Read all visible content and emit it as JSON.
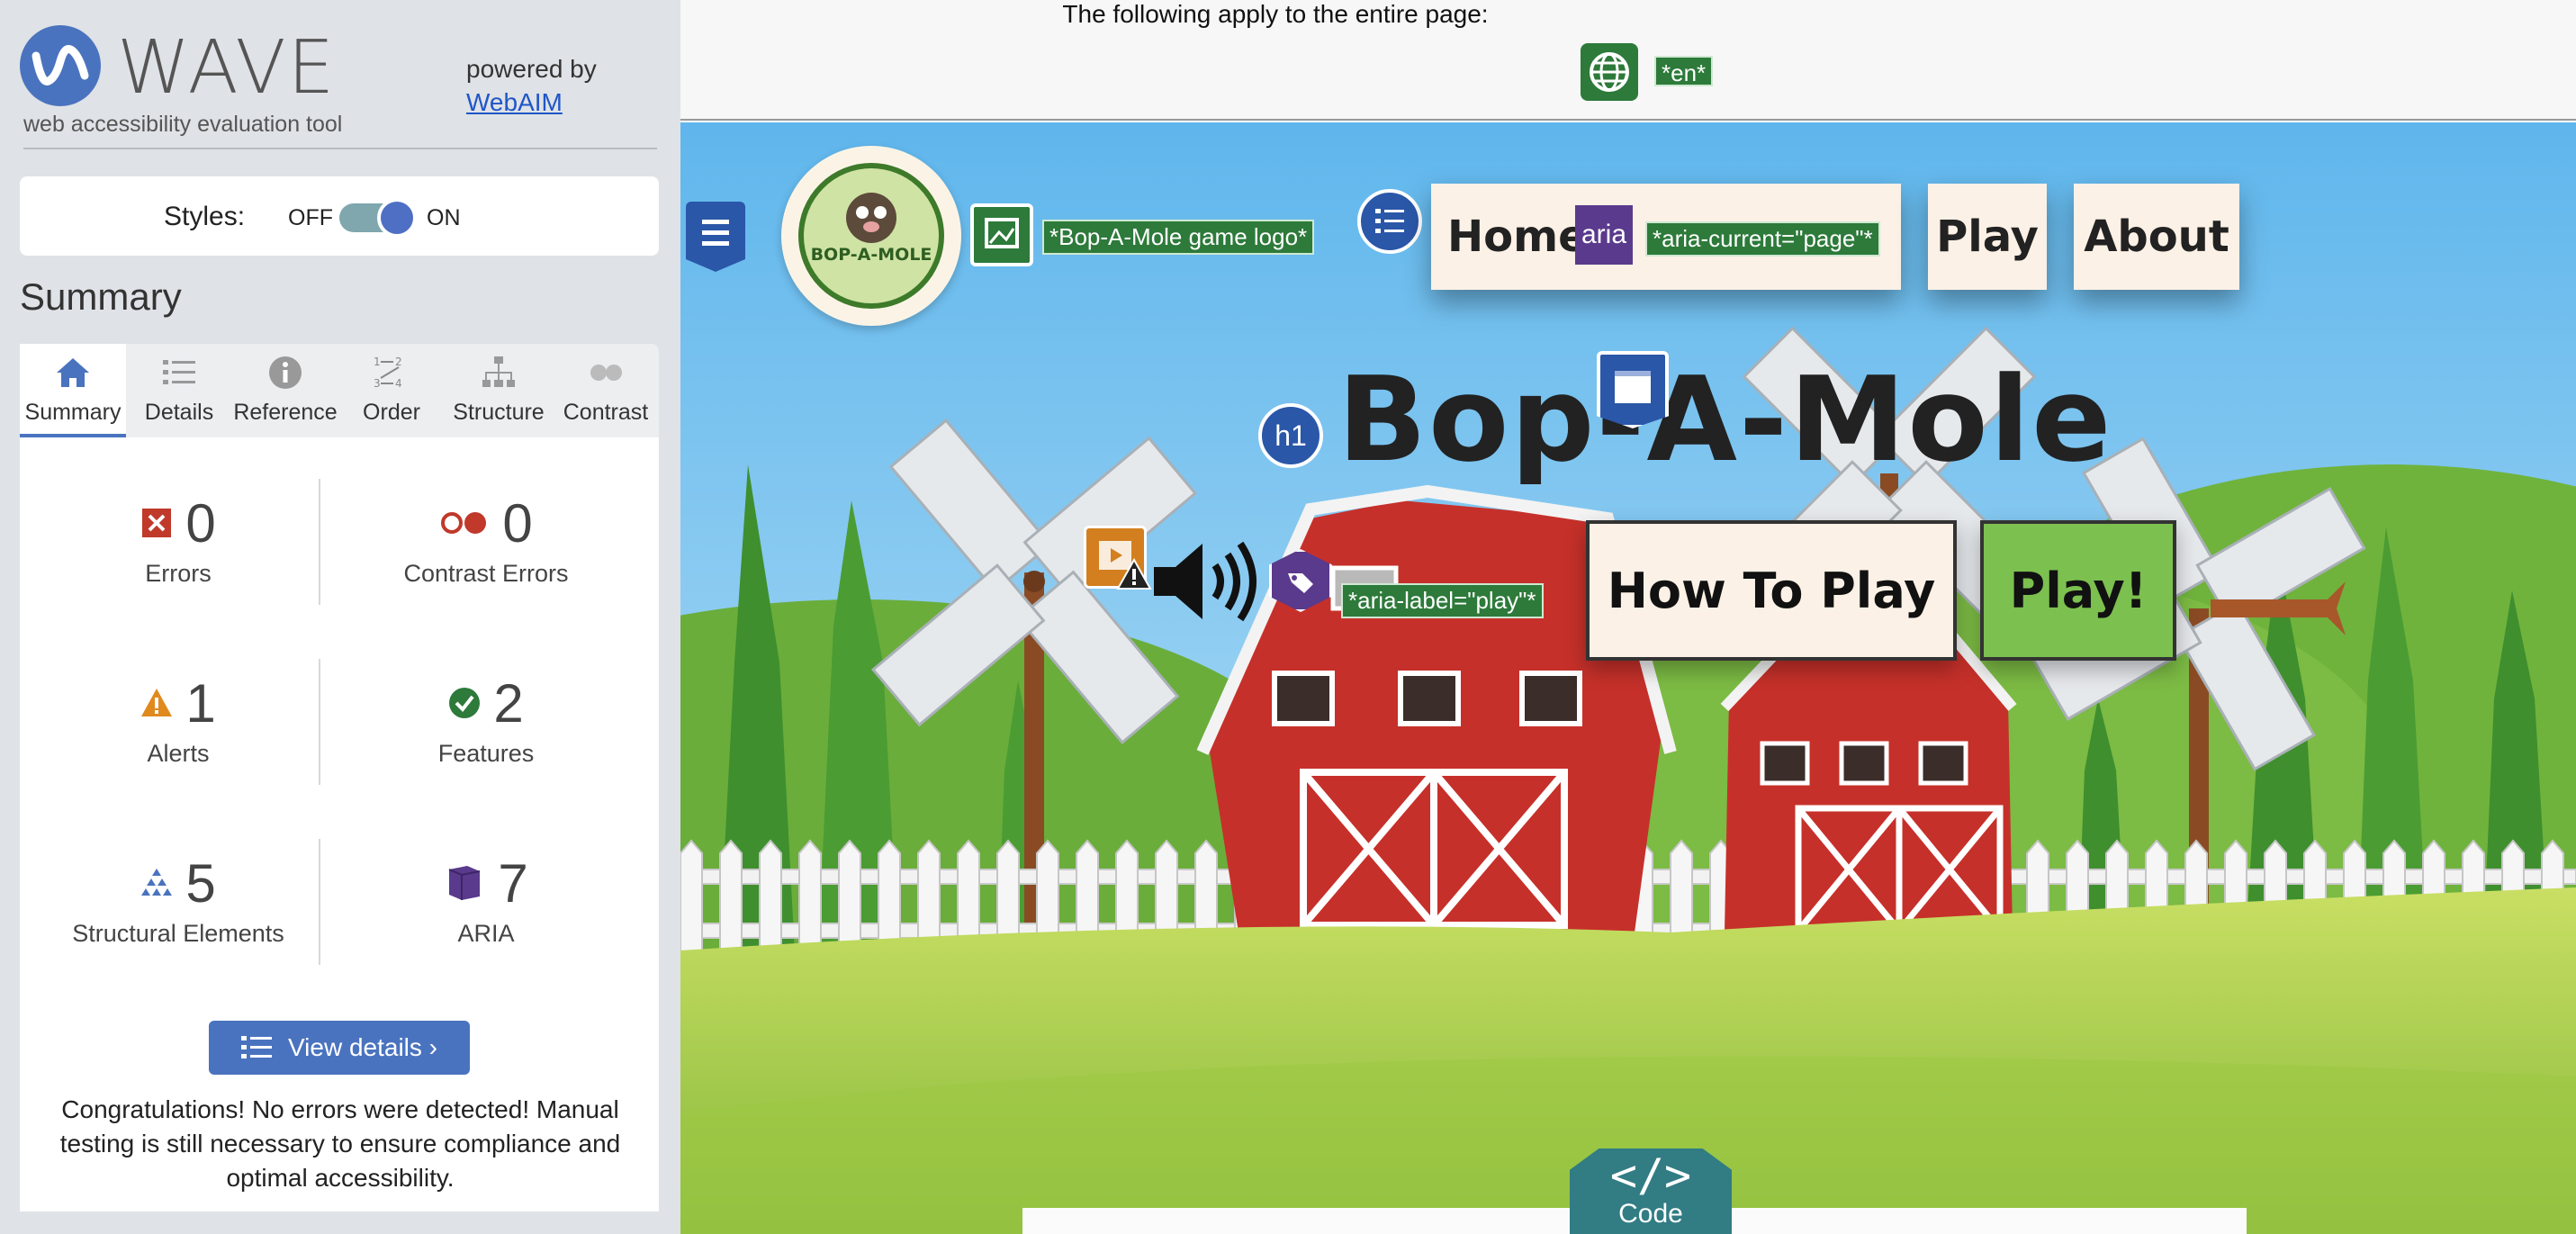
{
  "panel": {
    "brand": "WAVE",
    "tagline": "web accessibility evaluation tool",
    "powered_by": "powered by",
    "webaim_link": "WebAIM",
    "styles_label": "Styles:",
    "styles_off": "OFF",
    "styles_on": "ON",
    "styles_enabled": true,
    "summary_heading": "Summary",
    "tabs": [
      {
        "label": "Summary",
        "icon": "home-icon",
        "active": true
      },
      {
        "label": "Details",
        "icon": "list-icon",
        "active": false
      },
      {
        "label": "Reference",
        "icon": "info-icon",
        "active": false
      },
      {
        "label": "Order",
        "icon": "order-icon",
        "active": false
      },
      {
        "label": "Structure",
        "icon": "structure-icon",
        "active": false
      },
      {
        "label": "Contrast",
        "icon": "contrast-icon",
        "active": false
      }
    ],
    "stats": {
      "errors": {
        "count": "0",
        "label": "Errors"
      },
      "contrast_errors": {
        "count": "0",
        "label": "Contrast Errors"
      },
      "alerts": {
        "count": "1",
        "label": "Alerts"
      },
      "features": {
        "count": "2",
        "label": "Features"
      },
      "structural": {
        "count": "5",
        "label": "Structural Elements"
      },
      "aria": {
        "count": "7",
        "label": "ARIA"
      }
    },
    "view_details_label": "View details ›",
    "congrats": "Congratulations! No errors were detected! Manual testing is still necessary to ensure compliance and optimal accessibility."
  },
  "notice": {
    "text": "The following apply to the entire page:",
    "lang_tag": "*en*"
  },
  "page": {
    "logo_alt_tag": "*Bop-A-Mole game logo*",
    "logo_text": "BOP-A-MOLE",
    "nav": {
      "home": "Home",
      "aria_badge": "aria",
      "aria_current_tag": "*aria-current=\"page\"*",
      "play": "Play",
      "about": "About"
    },
    "h1_badge": "h1",
    "title": "Bop-A-Mole",
    "aria_label_tag": "*aria-label=\"play\"*",
    "how_to_play": "How To Play",
    "play_button": "Play!",
    "code_tab": "Code",
    "code_glyph": "</>"
  },
  "colors": {
    "wave_blue": "#4a73bf",
    "feature_green": "#2d7a3a",
    "play_green": "#7cc04f",
    "error_red": "#c0392b",
    "alert_orange": "#e08a1e",
    "aria_purple": "#5a3a8c",
    "sky": "#7fc6ee",
    "code_teal": "#327c84"
  }
}
